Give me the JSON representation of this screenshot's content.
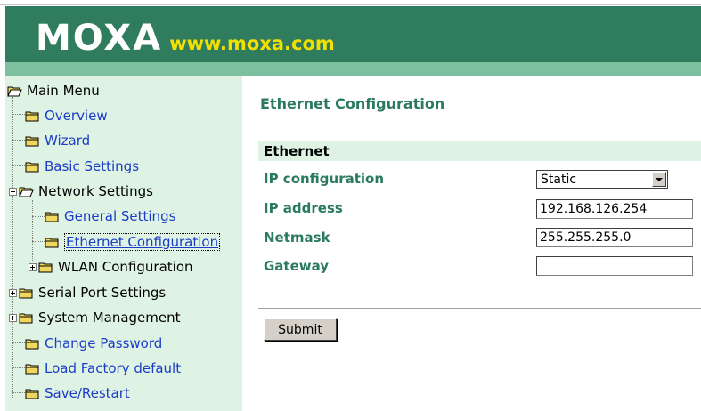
{
  "header": {
    "logo_text": "MOXA",
    "logo_url": "www.moxa.com",
    "colors": {
      "header_bg": "#2f7d5e",
      "header_band": "#7cc0a0",
      "url": "#f4e000"
    }
  },
  "sidebar": {
    "items": [
      {
        "label": "Main Menu",
        "icon": "open-folder-icon"
      },
      {
        "label": "Overview",
        "icon": "folder-icon"
      },
      {
        "label": "Wizard",
        "icon": "folder-icon"
      },
      {
        "label": "Basic Settings",
        "icon": "folder-icon"
      },
      {
        "label": "Network Settings",
        "icon": "open-folder-icon",
        "expander": "minus"
      },
      {
        "label": "General Settings",
        "icon": "folder-icon"
      },
      {
        "label": "Ethernet Configuration",
        "icon": "folder-icon",
        "selected": true
      },
      {
        "label": "WLAN Configuration",
        "icon": "folder-icon",
        "expander": "plus"
      },
      {
        "label": "Serial Port Settings",
        "icon": "folder-icon",
        "expander": "plus"
      },
      {
        "label": "System Management",
        "icon": "folder-icon",
        "expander": "plus"
      },
      {
        "label": "Change Password",
        "icon": "folder-icon"
      },
      {
        "label": "Load Factory default",
        "icon": "folder-icon"
      },
      {
        "label": "Save/Restart",
        "icon": "folder-icon"
      }
    ]
  },
  "main": {
    "title": "Ethernet Configuration",
    "section": "Ethernet",
    "fields": {
      "ip_configuration": {
        "label": "IP configuration",
        "value": "Static"
      },
      "ip_address": {
        "label": "IP address",
        "value": "192.168.126.254"
      },
      "netmask": {
        "label": "Netmask",
        "value": "255.255.255.0"
      },
      "gateway": {
        "label": "Gateway",
        "value": ""
      }
    },
    "submit_label": "Submit"
  }
}
